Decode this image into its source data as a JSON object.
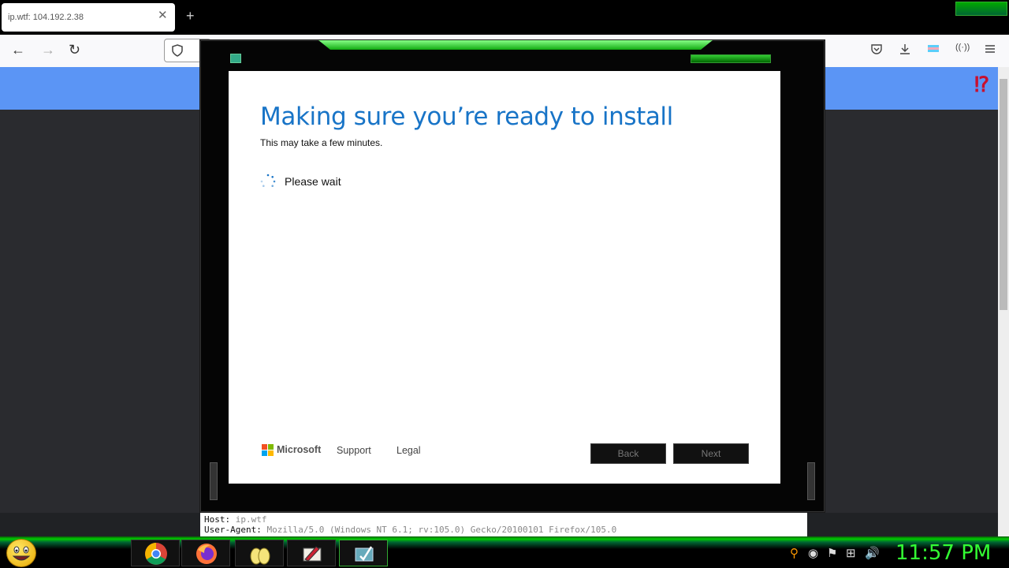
{
  "browser": {
    "tab_title": "ip.wtf: 104.192.2.38",
    "tab_close": "✕",
    "new_tab": "+",
    "nav": {
      "back": "←",
      "forward": "→",
      "reload": "↻"
    },
    "toolbar_icons": [
      "pocket-icon",
      "download-icon",
      "extension-icon",
      "reader-icon",
      "menu-icon"
    ]
  },
  "page": {
    "help_mark": "⁉",
    "host_label": "Host",
    "host_value": "ip.wtf",
    "ua_label": "User-Agent",
    "ua_value": "Mozilla/5.0 (Windows NT 6.1; rv:105.0) Gecko/20100101 Firefox/105.0"
  },
  "dialog": {
    "title": "Making sure you’re ready to install",
    "subtitle": "This may take a few minutes.",
    "status": "Please wait",
    "brand": "Microsoft",
    "links": {
      "support": "Support",
      "legal": "Legal"
    },
    "buttons": {
      "back": "Back",
      "next": "Next"
    }
  },
  "taskbar": {
    "apps": [
      "chrome-icon",
      "firefox-icon",
      "folder-icon",
      "paint-icon",
      "setup-icon"
    ],
    "clock": "11:57 PM"
  },
  "colors": {
    "accent_blue": "#1874c7",
    "skin_green": "#33ff33",
    "page_blue": "#5b95f5"
  }
}
